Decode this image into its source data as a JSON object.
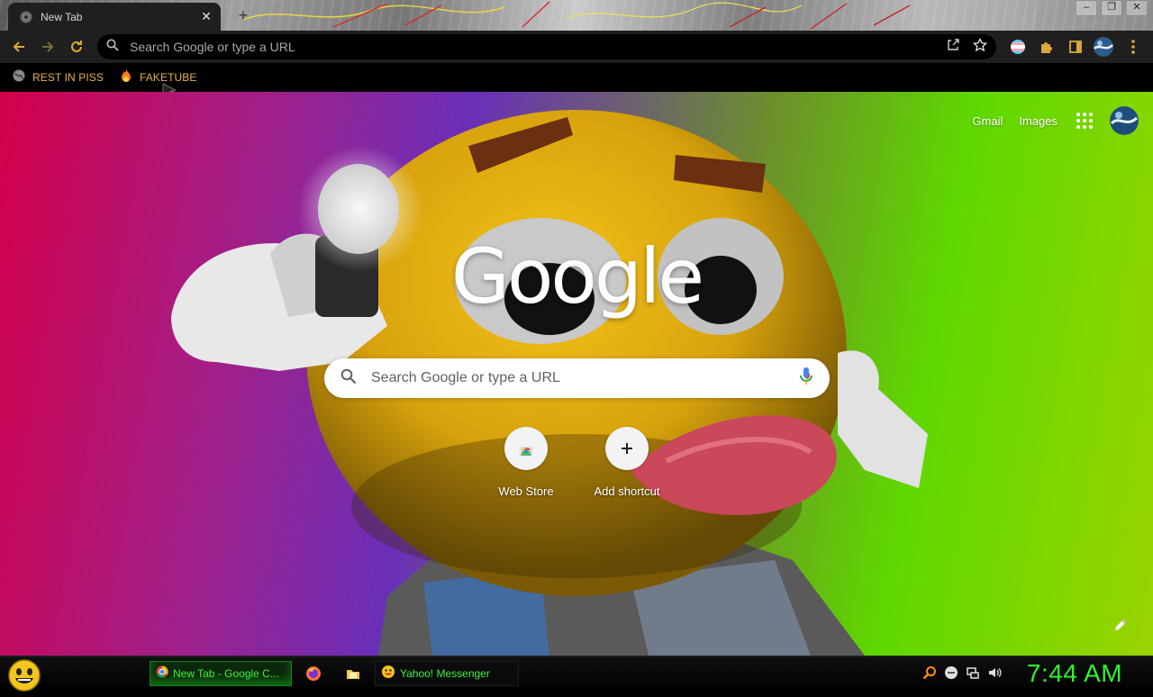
{
  "window": {
    "tab": {
      "title": "New Tab",
      "close_label": "✕"
    },
    "new_tab_label": "+",
    "controls": {
      "minimize": "–",
      "restore": "❐",
      "close": "✕"
    }
  },
  "toolbar": {
    "omnibox_placeholder": "Search Google or type a URL"
  },
  "bookmarks": [
    {
      "label": "REST IN PISS",
      "icon": "globe-icon"
    },
    {
      "label": "FAKETUBE",
      "icon": "fire-icon"
    }
  ],
  "ntp": {
    "links": {
      "gmail": "Gmail",
      "images": "Images"
    },
    "logo": "Google",
    "search_placeholder": "Search Google or type a URL",
    "shortcuts": [
      {
        "label": "Web Store",
        "icon": "chrome-web-store-icon"
      },
      {
        "label": "Add shortcut",
        "icon": "plus-icon"
      }
    ]
  },
  "taskbar": {
    "tasks": [
      {
        "label": "New Tab - Google C...",
        "icon": "chrome-icon",
        "active": true
      },
      {
        "label": "Yahoo! Messenger",
        "icon": "smiley-icon",
        "active": false
      }
    ],
    "clock": "7:44 AM"
  },
  "colors": {
    "accent_bookmark": "#e3b34a",
    "taskbar_text": "#3df23d",
    "clock": "#2ef52e",
    "toolbar_bg": "#1f1f1f"
  }
}
